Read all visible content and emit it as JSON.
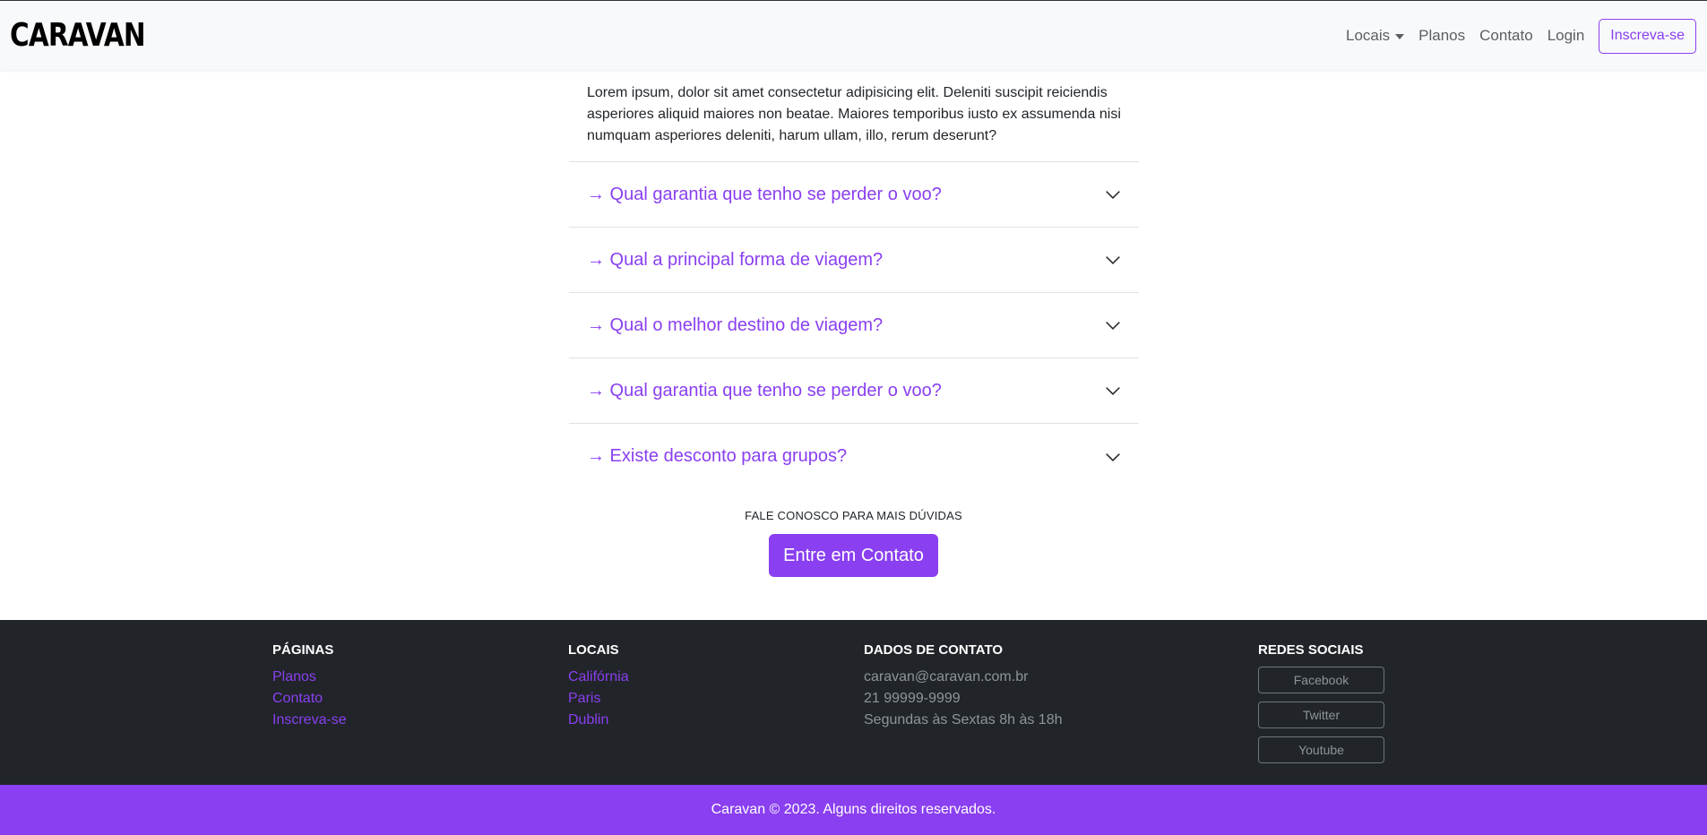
{
  "navbar": {
    "brand": "CARAVAN",
    "links": [
      {
        "label": "Locais"
      },
      {
        "label": "Planos"
      },
      {
        "label": "Contato"
      },
      {
        "label": "Login"
      }
    ],
    "cta": "Inscreva-se"
  },
  "faq": {
    "open_answer": "Lorem ipsum, dolor sit amet consectetur adipisicing elit. Deleniti suscipit reiciendis asperiores aliquid maiores non beatae. Maiores temporibus iusto ex assumenda nisi numquam asperiores deleniti, harum ullam, illo, rerum deserunt?",
    "questions": [
      "→ Qual garantia que tenho se perder o voo?",
      "→ Qual a principal forma de viagem?",
      "→ Qual o melhor destino de viagem?",
      "→ Qual garantia que tenho se perder o voo?",
      "→ Existe desconto para grupos?"
    ]
  },
  "contact": {
    "label": "FALE CONOSCO PARA MAIS DÚVIDAS",
    "button": "Entre em Contato"
  },
  "footer": {
    "pages": {
      "title": "PÁGINAS",
      "links": [
        "Planos",
        "Contato",
        "Inscreva-se"
      ]
    },
    "locations": {
      "title": "LOCAIS",
      "links": [
        "Califórnia",
        "Paris",
        "Dublin"
      ]
    },
    "contact": {
      "title": "DADOS DE CONTATO",
      "lines": [
        "caravan@caravan.com.br",
        "21 99999-9999",
        "Segundas às Sextas 8h às 18h"
      ]
    },
    "social": {
      "title": "REDES SOCIAIS",
      "buttons": [
        "Facebook",
        "Twitter",
        "Youtube"
      ]
    },
    "copyright": "Caravan © 2023. Alguns direitos reservados."
  },
  "colors": {
    "accent": "#8a3ff0",
    "footer_bg": "#212529",
    "navbar_bg": "#f8f9fa"
  }
}
